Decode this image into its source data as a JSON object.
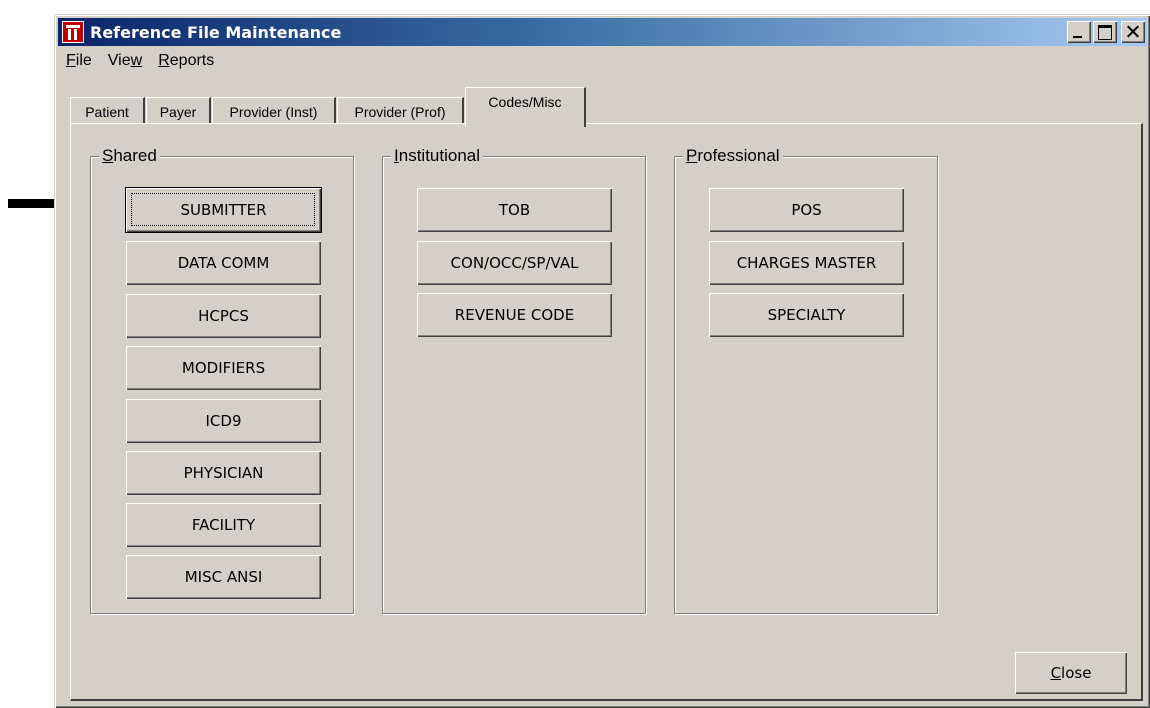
{
  "window": {
    "title": "Reference File Maintenance"
  },
  "menu": {
    "file": {
      "accel": "F",
      "rest": "ile"
    },
    "view": {
      "pre": "Vie",
      "accel": "w"
    },
    "reports": {
      "accel": "R",
      "rest": "eports"
    }
  },
  "tabs": [
    {
      "label": "Patient"
    },
    {
      "label": "Payer"
    },
    {
      "label": "Provider (Inst)"
    },
    {
      "label": "Provider (Prof)"
    },
    {
      "label": "Codes/Misc",
      "active": true
    }
  ],
  "groups": {
    "shared": {
      "legend_accel": "S",
      "legend_rest": "hared",
      "buttons": [
        "SUBMITTER",
        "DATA COMM",
        "HCPCS",
        "MODIFIERS",
        "ICD9",
        "PHYSICIAN",
        "FACILITY",
        "MISC ANSI"
      ]
    },
    "institutional": {
      "legend_accel": "I",
      "legend_rest": "nstitutional",
      "buttons": [
        "TOB",
        "CON/OCC/SP/VAL",
        "REVENUE CODE"
      ]
    },
    "professional": {
      "legend_accel": "P",
      "legend_rest": "rofessional",
      "buttons": [
        "POS",
        "CHARGES MASTER",
        "SPECIALTY"
      ]
    }
  },
  "close_button": {
    "accel": "C",
    "rest": "lose"
  }
}
